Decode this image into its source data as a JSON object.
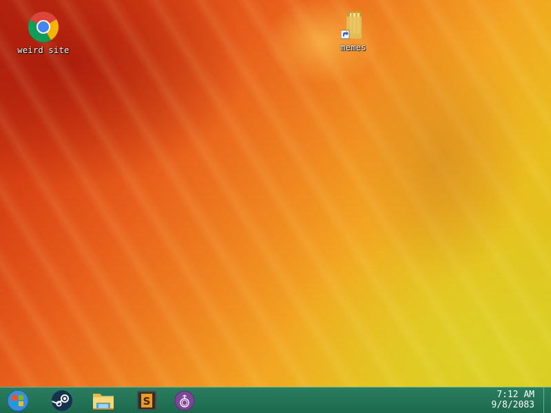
{
  "desktop": {
    "icons": [
      {
        "label": "weird site",
        "icon": "chrome-icon"
      },
      {
        "label": "memes",
        "icon": "folder-shortcut-icon"
      }
    ]
  },
  "taskbar": {
    "start_icon": "windows-logo-icon",
    "pinned": [
      {
        "name": "Steam",
        "icon": "steam-icon"
      },
      {
        "name": "File Explorer",
        "icon": "file-explorer-icon"
      },
      {
        "name": "Sublime Text",
        "icon": "sublime-text-icon"
      },
      {
        "name": "Tor Browser",
        "icon": "tor-browser-icon"
      }
    ],
    "clock": {
      "time": "7:12 AM",
      "date": "9/8/2083"
    }
  },
  "colors": {
    "taskbar": "#1c6a4e",
    "wallpaper_red": "#b8260e",
    "wallpaper_orange": "#ef8420",
    "wallpaper_yellow": "#d6c81c"
  }
}
